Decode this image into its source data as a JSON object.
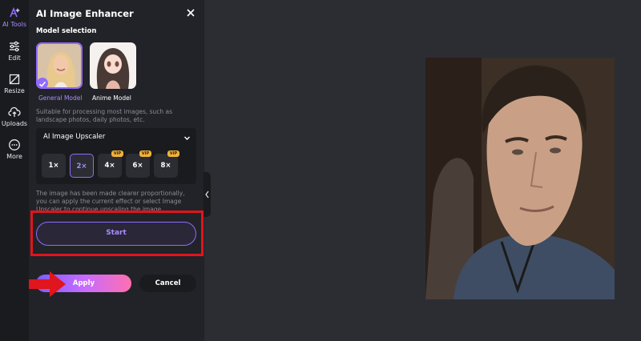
{
  "rail": {
    "items": [
      {
        "label": "AI Tools",
        "icon": "ai-tools-icon",
        "active": true
      },
      {
        "label": "Edit",
        "icon": "sliders-icon"
      },
      {
        "label": "Resize",
        "icon": "crop-icon"
      },
      {
        "label": "Uploads",
        "icon": "cloud-upload-icon"
      },
      {
        "label": "More",
        "icon": "more-circle-icon"
      }
    ]
  },
  "panel": {
    "title": "AI Image Enhancer",
    "section_label": "Model selection",
    "models": [
      {
        "label": "General Model",
        "selected": true
      },
      {
        "label": "Anime Model",
        "selected": false
      }
    ],
    "description": "Suitable for processing most images, such as landscape photos, daily photos, etc.",
    "upscaler": {
      "title": "AI Image Upscaler",
      "scales": [
        {
          "label": "1×",
          "vip": false,
          "selected": false
        },
        {
          "label": "2×",
          "vip": false,
          "selected": true
        },
        {
          "label": "4×",
          "vip": true,
          "selected": false
        },
        {
          "label": "6×",
          "vip": true,
          "selected": false
        },
        {
          "label": "8×",
          "vip": true,
          "selected": false
        }
      ],
      "vip_badge": "VIP"
    },
    "note": "The image has been made clearer proportionally, you can apply the current effect or select Image Upscaler to continue upscaling the image.",
    "start_label": "Start",
    "apply_label": "Apply",
    "cancel_label": "Cancel"
  },
  "colors": {
    "accent": "#8f6bff",
    "highlight_red": "#e0151d",
    "vip_gold": "#f0b23b",
    "panel_bg": "#222328",
    "canvas_bg": "#2c2d33"
  }
}
